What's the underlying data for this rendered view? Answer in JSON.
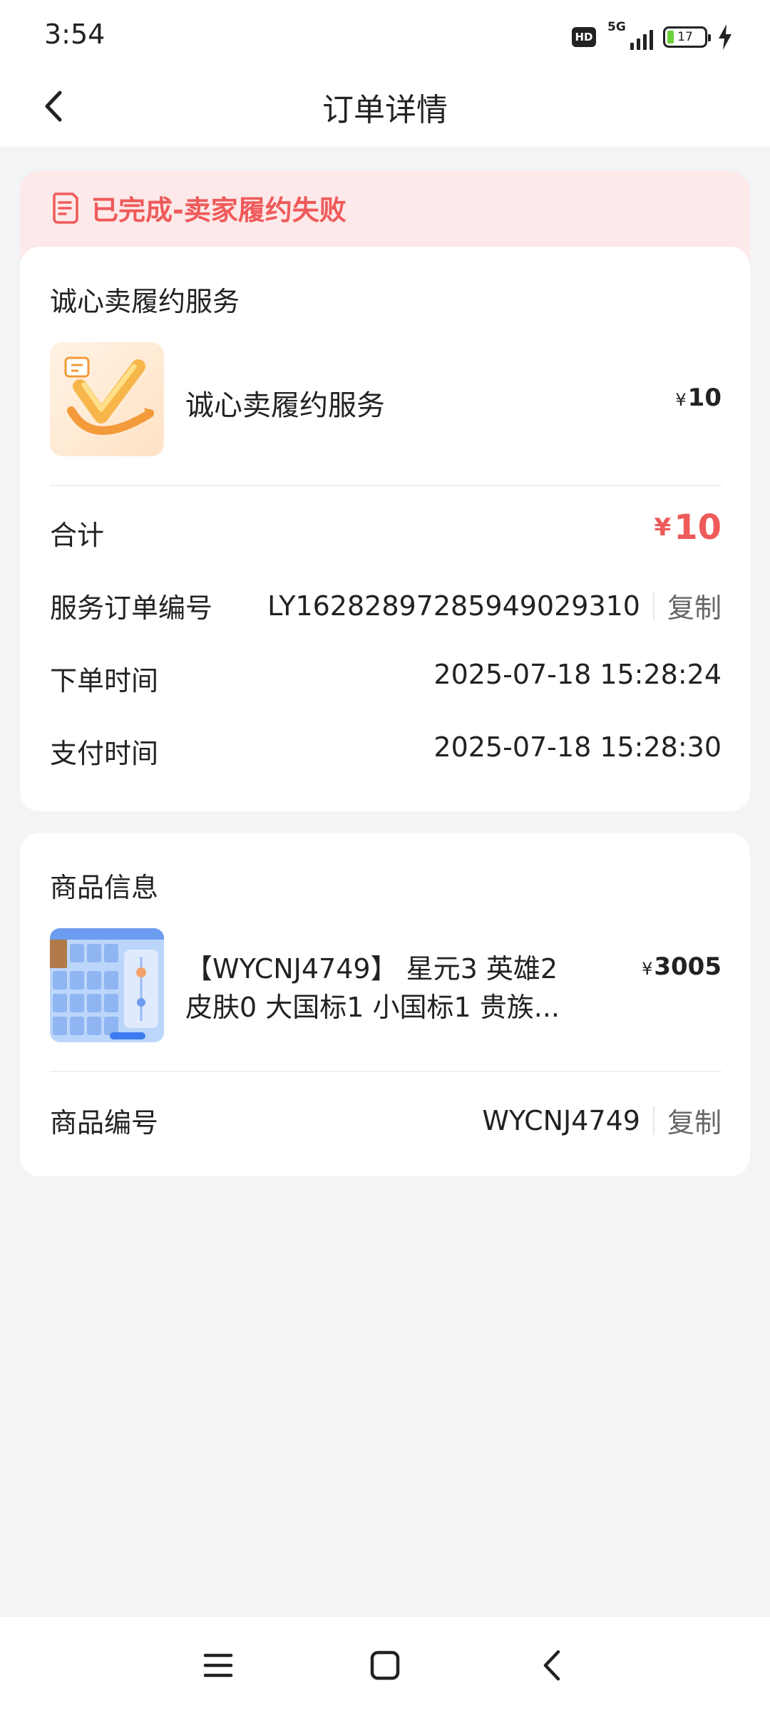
{
  "status_bar": {
    "time": "3:54",
    "hd_label": "HD",
    "network": "5G",
    "battery": "17"
  },
  "header": {
    "title": "订单详情"
  },
  "order_status": {
    "text": "已完成-卖家履约失败",
    "color": "#ef5a5a"
  },
  "service": {
    "section_title": "诚心卖履约服务",
    "item_name": "诚心卖履约服务",
    "currency": "¥",
    "item_price": "10",
    "total_label": "合计",
    "total_price": "10",
    "order_no_label": "服务订单编号",
    "order_no": "LY16282897285949029310",
    "copy_label": "复制",
    "order_time_label": "下单时间",
    "order_time": "2025-07-18 15:28:24",
    "pay_time_label": "支付时间",
    "pay_time": "2025-07-18 15:28:30"
  },
  "product": {
    "section_title": "商品信息",
    "title_line1": "【WYCNJ4749】 星元3 英雄2",
    "title_line2": "皮肤0  大国标1  小国标1 贵族...",
    "currency": "¥",
    "price": "3005",
    "id_label": "商品编号",
    "id": "WYCNJ4749",
    "copy_label": "复制"
  },
  "system_nav": {
    "icons": [
      "menu-icon",
      "home-square-icon",
      "back-chevron-icon"
    ]
  }
}
